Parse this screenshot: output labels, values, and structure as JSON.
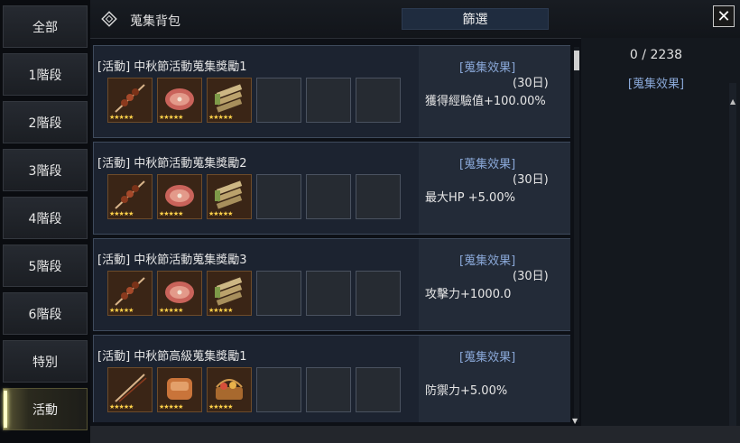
{
  "sidebar": {
    "items": [
      {
        "label": "全部"
      },
      {
        "label": "1階段"
      },
      {
        "label": "2階段"
      },
      {
        "label": "3階段"
      },
      {
        "label": "4階段"
      },
      {
        "label": "5階段"
      },
      {
        "label": "6階段"
      },
      {
        "label": "特別"
      },
      {
        "label": "活動",
        "active": true
      }
    ]
  },
  "header": {
    "title": "蒐集背包",
    "filter_label": "篩選",
    "close_symbol": "✕"
  },
  "cards": [
    {
      "name": "[活動] 中秋節活動蒐集獎勵1",
      "effect_link": "[蒐集效果]",
      "duration": "(30日)",
      "effect": "獲得經驗值+100.00%",
      "items": [
        {
          "icon": "skewer-icon",
          "stars": "★★★★★"
        },
        {
          "icon": "meat-icon",
          "stars": "★★★★★"
        },
        {
          "icon": "vegetable-bundle-icon",
          "stars": "★★★★★"
        }
      ]
    },
    {
      "name": "[活動] 中秋節活動蒐集獎勵2",
      "effect_link": "[蒐集效果]",
      "duration": "(30日)",
      "effect": "最大HP +5.00%",
      "items": [
        {
          "icon": "skewer-icon",
          "stars": "★★★★★"
        },
        {
          "icon": "meat-icon",
          "stars": "★★★★★"
        },
        {
          "icon": "vegetable-bundle-icon",
          "stars": "★★★★★"
        }
      ]
    },
    {
      "name": "[活動] 中秋節活動蒐集獎勵3",
      "effect_link": "[蒐集效果]",
      "duration": "(30日)",
      "effect": "攻擊力+1000.0",
      "items": [
        {
          "icon": "skewer-icon",
          "stars": "★★★★★"
        },
        {
          "icon": "meat-icon",
          "stars": "★★★★★"
        },
        {
          "icon": "vegetable-bundle-icon",
          "stars": "★★★★★"
        }
      ]
    },
    {
      "name": "[活動] 中秋節高級蒐集獎勵1",
      "effect_link": "[蒐集效果]",
      "duration": "",
      "effect": "防禦力+5.00%",
      "items": [
        {
          "icon": "skewer-icon",
          "stars": "★★★★★"
        },
        {
          "icon": "roast-meat-icon",
          "stars": "★★★★★"
        },
        {
          "icon": "food-basket-icon",
          "stars": "★★★★★"
        }
      ]
    }
  ],
  "right_panel": {
    "count": "0 / 2238",
    "effect_link": "[蒐集效果]"
  },
  "colors": {
    "accent_link": "#8aa8d8",
    "active_highlight": "#ffffc8",
    "star": "#ffd24a"
  }
}
